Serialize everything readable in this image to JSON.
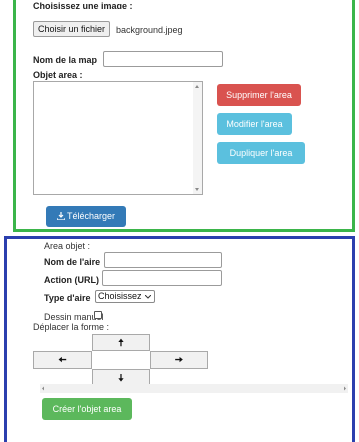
{
  "top_panel": {
    "image_label": "Choisissez une image :",
    "file_button_label": "Choisir un fichier",
    "file_name": "background.jpeg",
    "map_name_label": "Nom de la map",
    "map_name_value": "",
    "objet_area_label": "Objet area :",
    "objet_area_value": "",
    "delete_button": "Supprimer l'area",
    "modify_button": "Modifier l'area",
    "duplicate_button": "Dupliquer l'area",
    "download_button": "Télécharger",
    "download_icon": "download-icon"
  },
  "bottom_panel": {
    "area_objet_label": "Area objet :",
    "area_name_label": "Nom de l'aire",
    "area_name_value": "",
    "action_label": "Action (URL)",
    "action_value": "",
    "area_type_label": "Type d'aire",
    "area_type_selected": "Choisissez",
    "manual_draw_label": "Dessin manuel",
    "manual_draw_checked": false,
    "move_shape_label": "Déplacer la forme :",
    "arrows": {
      "up": "🠅",
      "left": "🠄",
      "right": "🠆",
      "down": "🠇"
    },
    "create_button": "Créer l'objet area"
  },
  "colors": {
    "top_border": "#3bb54a",
    "bottom_border": "#2b3fae",
    "danger": "#d9534f",
    "info": "#5bc0de",
    "primary": "#337ab7",
    "success": "#5cb85c"
  }
}
